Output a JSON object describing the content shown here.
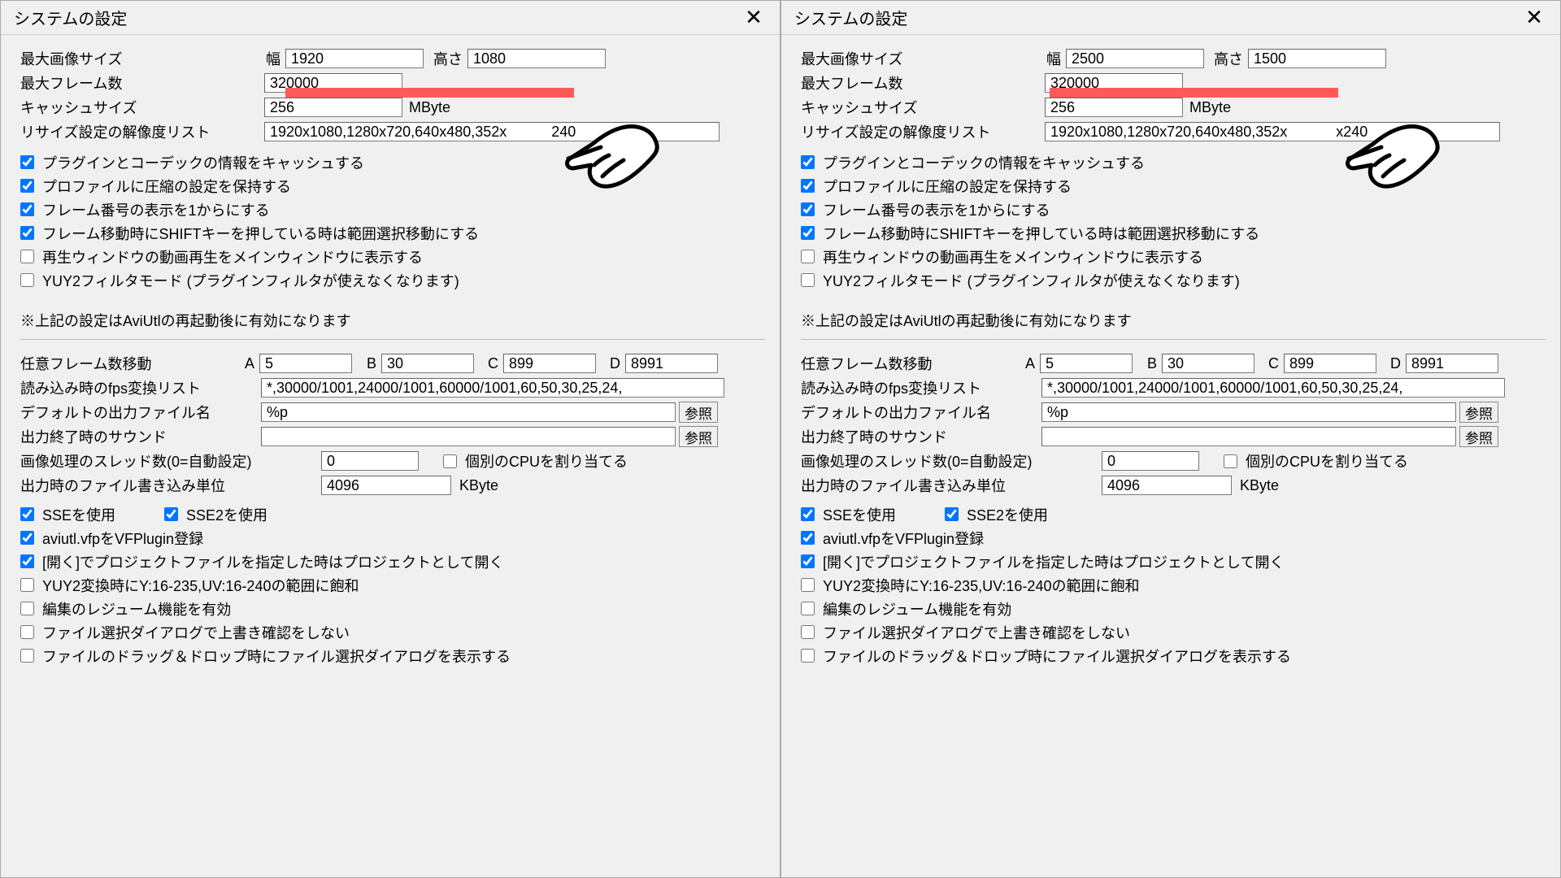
{
  "dialogs": [
    {
      "title": "システムの設定",
      "maxsize_label": "最大画像サイズ",
      "width_label": "幅",
      "width": "1920",
      "height_label": "高さ",
      "height": "1080",
      "maxframes_label": "最大フレーム数",
      "maxframes": "320000",
      "cache_label": "キャッシュサイズ",
      "cache": "256",
      "cache_unit": "MByte",
      "resize_label": "リサイズ設定の解像度リスト",
      "resize_list": "1920x1080,1280x720,640x480,352x           240",
      "checks1": [
        {
          "c": true,
          "t": "プラグインとコーデックの情報をキャッシュする"
        },
        {
          "c": true,
          "t": "プロファイルに圧縮の設定を保持する"
        },
        {
          "c": true,
          "t": "フレーム番号の表示を1からにする"
        },
        {
          "c": true,
          "t": "フレーム移動時にSHIFTキーを押している時は範囲選択移動にする"
        },
        {
          "c": false,
          "t": "再生ウィンドウの動画再生をメインウィンドウに表示する"
        },
        {
          "c": false,
          "t": "YUY2フィルタモード (プラグインフィルタが使えなくなります)"
        }
      ],
      "note": "※上記の設定はAviUtlの再起動後に有効になります",
      "jump_label": "任意フレーム数移動",
      "jump": {
        "A": "5",
        "B": "30",
        "C": "899",
        "D": "8991"
      },
      "fps_label": "読み込み時のfps変換リスト",
      "fps_list": "*,30000/1001,24000/1001,60000/1001,60,50,30,25,24,",
      "outfile_label": "デフォルトの出力ファイル名",
      "outfile": "%p",
      "browse": "参照",
      "sound_label": "出力終了時のサウンド",
      "sound": "",
      "threads_label": "画像処理のスレッド数(0=自動設定)",
      "threads": "0",
      "percpu_label": "個別のCPUを割り当てる",
      "percpu": false,
      "writeunit_label": "出力時のファイル書き込み単位",
      "writeunit": "4096",
      "writeunit_unit": "KByte",
      "sse_label": "SSEを使用",
      "sse": true,
      "sse2_label": "SSE2を使用",
      "sse2": true,
      "checks2": [
        {
          "c": true,
          "t": "aviutl.vfpをVFPlugin登録"
        },
        {
          "c": true,
          "t": "[開く]でプロジェクトファイルを指定した時はプロジェクトとして開く"
        },
        {
          "c": false,
          "t": "YUY2変換時にY:16-235,UV:16-240の範囲に飽和"
        },
        {
          "c": false,
          "t": "編集のレジューム機能を有効"
        },
        {
          "c": false,
          "t": "ファイル選択ダイアログで上書き確認をしない"
        },
        {
          "c": false,
          "t": "ファイルのドラッグ＆ドロップ時にファイル選択ダイアログを表示する"
        }
      ]
    },
    {
      "title": "システムの設定",
      "maxsize_label": "最大画像サイズ",
      "width_label": "幅",
      "width": "2500",
      "height_label": "高さ",
      "height": "1500",
      "maxframes_label": "最大フレーム数",
      "maxframes": "320000",
      "cache_label": "キャッシュサイズ",
      "cache": "256",
      "cache_unit": "MByte",
      "resize_label": "リサイズ設定の解像度リスト",
      "resize_list": "1920x1080,1280x720,640x480,352x            x240",
      "checks1": [
        {
          "c": true,
          "t": "プラグインとコーデックの情報をキャッシュする"
        },
        {
          "c": true,
          "t": "プロファイルに圧縮の設定を保持する"
        },
        {
          "c": true,
          "t": "フレーム番号の表示を1からにする"
        },
        {
          "c": true,
          "t": "フレーム移動時にSHIFTキーを押している時は範囲選択移動にする"
        },
        {
          "c": false,
          "t": "再生ウィンドウの動画再生をメインウィンドウに表示する"
        },
        {
          "c": false,
          "t": "YUY2フィルタモード (プラグインフィルタが使えなくなります)"
        }
      ],
      "note": "※上記の設定はAviUtlの再起動後に有効になります",
      "jump_label": "任意フレーム数移動",
      "jump": {
        "A": "5",
        "B": "30",
        "C": "899",
        "D": "8991"
      },
      "fps_label": "読み込み時のfps変換リスト",
      "fps_list": "*,30000/1001,24000/1001,60000/1001,60,50,30,25,24,",
      "outfile_label": "デフォルトの出力ファイル名",
      "outfile": "%p",
      "browse": "参照",
      "sound_label": "出力終了時のサウンド",
      "sound": "",
      "threads_label": "画像処理のスレッド数(0=自動設定)",
      "threads": "0",
      "percpu_label": "個別のCPUを割り当てる",
      "percpu": false,
      "writeunit_label": "出力時のファイル書き込み単位",
      "writeunit": "4096",
      "writeunit_unit": "KByte",
      "sse_label": "SSEを使用",
      "sse": true,
      "sse2_label": "SSE2を使用",
      "sse2": true,
      "checks2": [
        {
          "c": true,
          "t": "aviutl.vfpをVFPlugin登録"
        },
        {
          "c": true,
          "t": "[開く]でプロジェクトファイルを指定した時はプロジェクトとして開く"
        },
        {
          "c": false,
          "t": "YUY2変換時にY:16-235,UV:16-240の範囲に飽和"
        },
        {
          "c": false,
          "t": "編集のレジューム機能を有効"
        },
        {
          "c": false,
          "t": "ファイル選択ダイアログで上書き確認をしない"
        },
        {
          "c": false,
          "t": "ファイルのドラッグ＆ドロップ時にファイル選択ダイアログを表示する"
        }
      ]
    }
  ]
}
